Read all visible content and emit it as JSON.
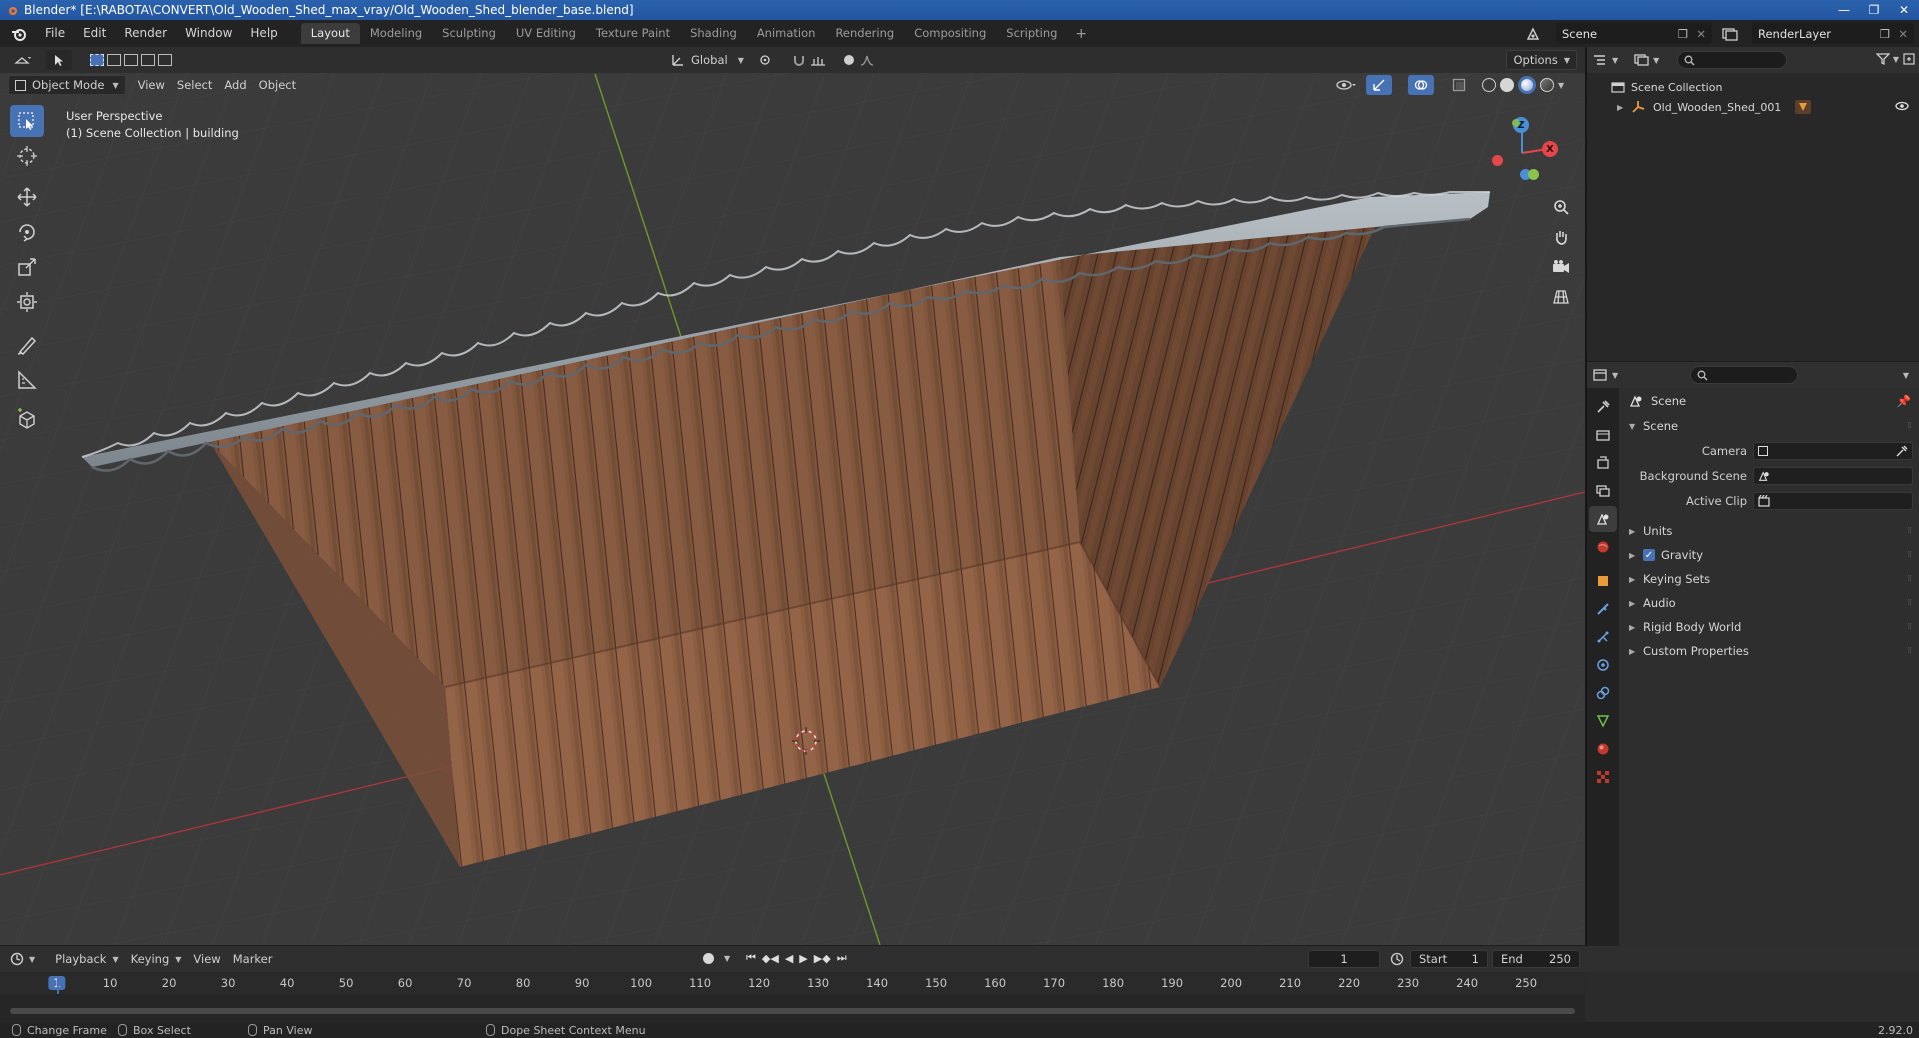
{
  "window": {
    "title": "Blender* [E:\\RABOTA\\CONVERT\\Old_Wooden_Shed_max_vray/Old_Wooden_Shed_blender_base.blend]",
    "controls": [
      "—",
      "❐",
      "✕"
    ]
  },
  "menubar": {
    "items": [
      "File",
      "Edit",
      "Render",
      "Window",
      "Help"
    ],
    "workspaces": [
      "Layout",
      "Modeling",
      "Sculpting",
      "UV Editing",
      "Texture Paint",
      "Shading",
      "Animation",
      "Rendering",
      "Compositing",
      "Scripting"
    ],
    "active_workspace": "Layout",
    "add_tab": "+",
    "scene_name": "Scene",
    "view_layer": "RenderLayer"
  },
  "viewport": {
    "mode": "Object Mode",
    "menus": [
      "View",
      "Select",
      "Add",
      "Object"
    ],
    "orientation": "Global",
    "options_label": "Options",
    "perspective_label": "User Perspective",
    "collection_label": "(1) Scene Collection | building",
    "gizmo_axes": {
      "x": "X",
      "y": "Y",
      "z": "Z"
    }
  },
  "outliner": {
    "root": "Scene Collection",
    "items": [
      {
        "name": "Old_Wooden_Shed_001"
      }
    ]
  },
  "properties": {
    "context_title": "Scene",
    "panel_title": "Scene",
    "fields": [
      {
        "label": "Camera",
        "value": ""
      },
      {
        "label": "Background Scene",
        "value": ""
      },
      {
        "label": "Active Clip",
        "value": ""
      }
    ],
    "subpanels": [
      {
        "label": "Units",
        "checkbox": false
      },
      {
        "label": "Gravity",
        "checkbox": true
      },
      {
        "label": "Keying Sets",
        "checkbox": false
      },
      {
        "label": "Audio",
        "checkbox": false
      },
      {
        "label": "Rigid Body World",
        "checkbox": false
      },
      {
        "label": "Custom Properties",
        "checkbox": false
      }
    ]
  },
  "timeline": {
    "menus": [
      "Playback",
      "Keying",
      "View",
      "Marker"
    ],
    "current_frame": "1",
    "start_label": "Start",
    "start": "1",
    "end_label": "End",
    "end": "250",
    "ruler_ticks": [
      "1",
      "10",
      "20",
      "30",
      "40",
      "50",
      "60",
      "70",
      "80",
      "90",
      "100",
      "110",
      "120",
      "130",
      "140",
      "150",
      "160",
      "170",
      "180",
      "190",
      "200",
      "210",
      "220",
      "230",
      "240",
      "250"
    ]
  },
  "statusbar": {
    "items": [
      "Change Frame",
      "Box Select",
      "Pan View",
      "Dope Sheet Context Menu"
    ],
    "version": "2.92.0"
  },
  "colors": {
    "accent": "#4772b3",
    "x_axis": "#e5464c",
    "y_axis": "#8bc34a",
    "z_axis": "#4a90d9",
    "wood": "#8a5f45",
    "metal": "#9aa3aa"
  }
}
